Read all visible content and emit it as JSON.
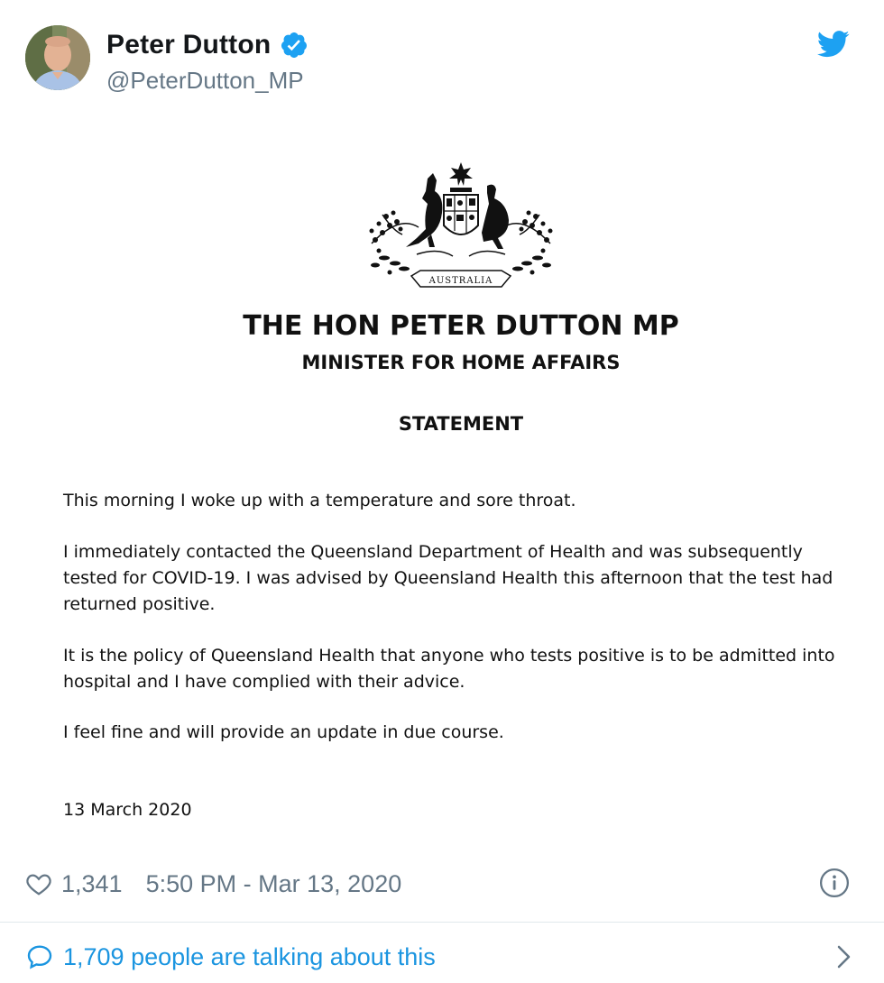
{
  "author": {
    "name": "Peter Dutton",
    "handle": "@PeterDutton_MP",
    "verified": true
  },
  "icons": {
    "avatar": "avatar-photo",
    "verified": "verified-badge-icon",
    "brand": "twitter-bird-icon",
    "like": "heart-icon",
    "info": "info-icon",
    "comment": "comment-icon",
    "chevron": "chevron-right-icon"
  },
  "statement": {
    "crest_text": "AUSTRALIA",
    "title": "THE HON PETER DUTTON MP",
    "subtitle": "MINISTER FOR HOME AFFAIRS",
    "heading": "STATEMENT",
    "paragraphs": [
      "This morning I woke up with a temperature and sore throat.",
      "I immediately contacted the Queensland Department of Health and was subsequently tested for COVID-19. I was advised by Queensland Health this afternoon that the test had returned positive.",
      "It is the policy of Queensland Health that anyone who tests positive is to be admitted into hospital and I have complied with their advice.",
      "I feel fine and will provide an update in due course."
    ],
    "date": "13 March 2020"
  },
  "meta": {
    "likes": "1,341",
    "timestamp": "5:50 PM - Mar 13, 2020"
  },
  "conversation": {
    "label": "1,709 people are talking about this"
  },
  "colors": {
    "twitter_blue": "#1da1f2",
    "link_blue": "#1b95e0",
    "secondary_text": "#657786",
    "divider": "#e1e8ed"
  }
}
